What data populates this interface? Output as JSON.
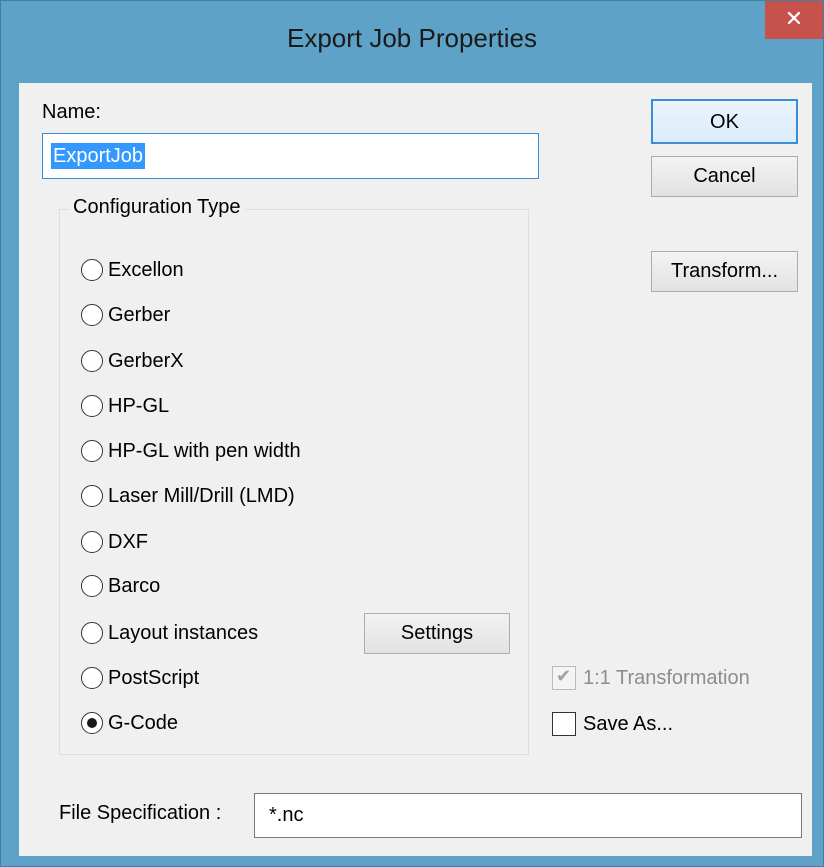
{
  "window": {
    "title": "Export Job Properties",
    "close_glyph": "✕"
  },
  "name": {
    "label": "Name:",
    "value": "ExportJob"
  },
  "buttons": {
    "ok": "OK",
    "cancel": "Cancel",
    "transform": "Transform...",
    "settings": "Settings"
  },
  "configuration": {
    "legend": "Configuration Type",
    "selected": "G-Code",
    "options": [
      {
        "label": "Excellon",
        "checked": false
      },
      {
        "label": "Gerber",
        "checked": false
      },
      {
        "label": "GerberX",
        "checked": false
      },
      {
        "label": "HP-GL",
        "checked": false
      },
      {
        "label": "HP-GL with pen width",
        "checked": false
      },
      {
        "label": "Laser Mill/Drill (LMD)",
        "checked": false
      },
      {
        "label": "DXF",
        "checked": false
      },
      {
        "label": "Barco",
        "checked": false
      },
      {
        "label": "Layout instances",
        "checked": false
      },
      {
        "label": "PostScript",
        "checked": false
      },
      {
        "label": "G-Code",
        "checked": true
      }
    ]
  },
  "options": {
    "one_to_one": {
      "label": "1:1 Transformation",
      "checked": true,
      "disabled": true
    },
    "save_as": {
      "label": "Save As...",
      "checked": false,
      "disabled": false
    }
  },
  "file_spec": {
    "label": "File Specification :",
    "value": "*.nc"
  },
  "colors": {
    "title_bar": "#5ea3c7",
    "close_button": "#c7514b",
    "selection": "#3399ff",
    "dialog_bg": "#f0f0f0"
  }
}
